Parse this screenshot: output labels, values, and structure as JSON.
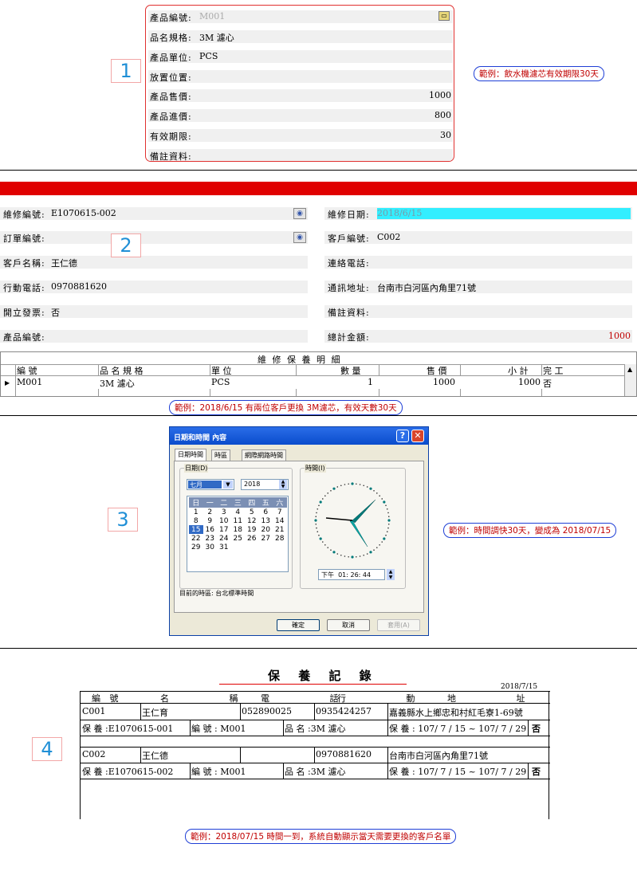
{
  "section1": {
    "step": "1",
    "fields": [
      {
        "label": "產品編號:",
        "value": "M001",
        "align": "left"
      },
      {
        "label": "品名規格:",
        "value": "3M 濾心",
        "align": "left"
      },
      {
        "label": "產品單位:",
        "value": "PCS",
        "align": "left"
      },
      {
        "label": "放置位置:",
        "value": "",
        "align": "left"
      },
      {
        "label": "產品售價:",
        "value": "1000",
        "align": "right"
      },
      {
        "label": "產品進價:",
        "value": "800",
        "align": "right"
      },
      {
        "label": "有效期限:",
        "value": "30",
        "align": "right"
      },
      {
        "label": "備註資料:",
        "value": "",
        "align": "left"
      }
    ],
    "note": "範例：飲水機濾芯有效期限30天"
  },
  "section2": {
    "step": "2",
    "left_fields": [
      {
        "label": "維修編號:",
        "value": "E1070615-002"
      },
      {
        "label": "訂單編號:",
        "value": ""
      },
      {
        "label": "客戶名稱:",
        "value": "王仁德"
      },
      {
        "label": "行動電話:",
        "value": "0970881620"
      },
      {
        "label": "開立發票:",
        "value": "否"
      },
      {
        "label": "產品編號:",
        "value": ""
      }
    ],
    "right_fields": [
      {
        "label": "維修日期:",
        "value": "2018/6/15"
      },
      {
        "label": "客戶編號:",
        "value": "C002"
      },
      {
        "label": "連絡電話:",
        "value": ""
      },
      {
        "label": "通訊地址:",
        "value": "台南市白河區內角里71號"
      },
      {
        "label": "備註資料:",
        "value": ""
      },
      {
        "label": "總計金額:",
        "value": "1000"
      }
    ],
    "grid": {
      "title": "維 修 保 養 明 細",
      "headers": [
        "編 號",
        "品 名 規 格",
        "單 位",
        "數 量",
        "售 價",
        "小 計",
        "完 工"
      ],
      "row": [
        "M001",
        "3M 濾心",
        "PCS",
        "1",
        "1000",
        "1000",
        "否"
      ]
    },
    "note": "範例：2018/6/15 有兩位客戶更換 3M濾芯，有效天數30天"
  },
  "section3": {
    "step": "3",
    "dialog_title": "日期和時間 內容",
    "tabs": [
      "日期時間",
      "時區",
      "網際網路時間"
    ],
    "date_group": "日期(D)",
    "time_group": "時間(I)",
    "month": "七月",
    "year": "2018",
    "weekdays": [
      "日",
      "一",
      "二",
      "三",
      "四",
      "五",
      "六"
    ],
    "days": [
      [
        "",
        "1",
        "2",
        "3",
        "4",
        "5",
        "6",
        "7"
      ],
      [
        "8",
        "9",
        "10",
        "11",
        "12",
        "13",
        "14"
      ],
      [
        "15",
        "16",
        "17",
        "18",
        "19",
        "20",
        "21"
      ],
      [
        "22",
        "23",
        "24",
        "25",
        "26",
        "27",
        "28"
      ],
      [
        "29",
        "30",
        "31",
        "",
        "",
        "",
        ""
      ]
    ],
    "selected_day": "15",
    "time_value": "下午  01: 26: 44",
    "timezone": "目前的時區: 台北標準時間",
    "buttons": {
      "ok": "確定",
      "cancel": "取消",
      "apply": "套用(A)"
    },
    "note": "範例：時間調快30天，變成為 2018/07/15"
  },
  "section4": {
    "step": "4",
    "title": "保 養 記 錄",
    "date": "2018/7/15",
    "headers": [
      "編 號",
      "名 稱",
      "電 話",
      "行 動",
      "地 址"
    ],
    "records": [
      {
        "id": "C001",
        "name": "王仁育",
        "phone": "052890025",
        "mobile": "0935424257",
        "address": "嘉義縣水上鄉忠和村紅毛寮1-69號",
        "service": "保 養 :E1070615-001",
        "item_no": "編 號 : M001",
        "item_name": "品 名 :3M 濾心",
        "period": "保 養 : 107/ 7 / 15 ~ 107/ 7 / 29",
        "done": "否"
      },
      {
        "id": "C002",
        "name": "王仁德",
        "phone": "",
        "mobile": "0970881620",
        "address": "台南市白河區內角里71號",
        "service": "保 養 :E1070615-002",
        "item_no": "編 號 : M001",
        "item_name": "品 名 :3M 濾心",
        "period": "保 養 : 107/ 7 / 15 ~ 107/ 7 / 29",
        "done": "否"
      }
    ],
    "note": "範例：2018/07/15 時間一到，系統自動顯示當天需要更換的客戶名單"
  },
  "colors": {
    "accent_red": "#e00000",
    "note_border": "#1f3fd6",
    "selected_cyan": "#33eeff"
  }
}
